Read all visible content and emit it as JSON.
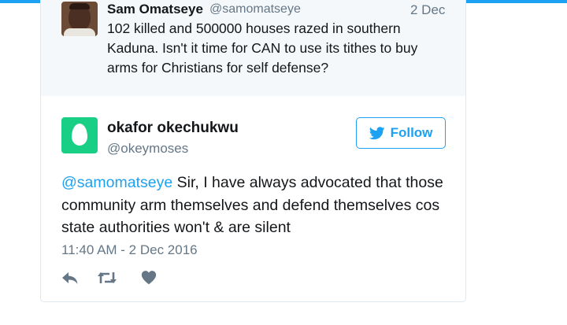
{
  "parent_tweet": {
    "author_name": "Sam Omatseye",
    "author_handle": "@samomatseye",
    "date": "2 Dec",
    "text": "102 killed and 500000 houses razed in southern Kaduna. Isn't it time for CAN to use its tithes to buy arms for Christians for self defense?"
  },
  "main_tweet": {
    "author_name": "okafor okechukwu",
    "author_handle": "@okeymoses",
    "follow_label": "Follow",
    "mention": "@samomatseye",
    "text": " Sir, I have always advocated that those community arm themselves and defend themselves cos state authorities won't & are silent",
    "timestamp": "11:40 AM - 2 Dec 2016"
  },
  "icons": [
    "reply-icon",
    "retweet-icon",
    "like-icon",
    "twitter-bird-icon",
    "egg-avatar"
  ],
  "colors": {
    "accent": "#1da1f2",
    "egg_bg": "#19cf86",
    "muted": "#657786",
    "text": "#14171a",
    "parent_bg": "#f5f8fa"
  }
}
